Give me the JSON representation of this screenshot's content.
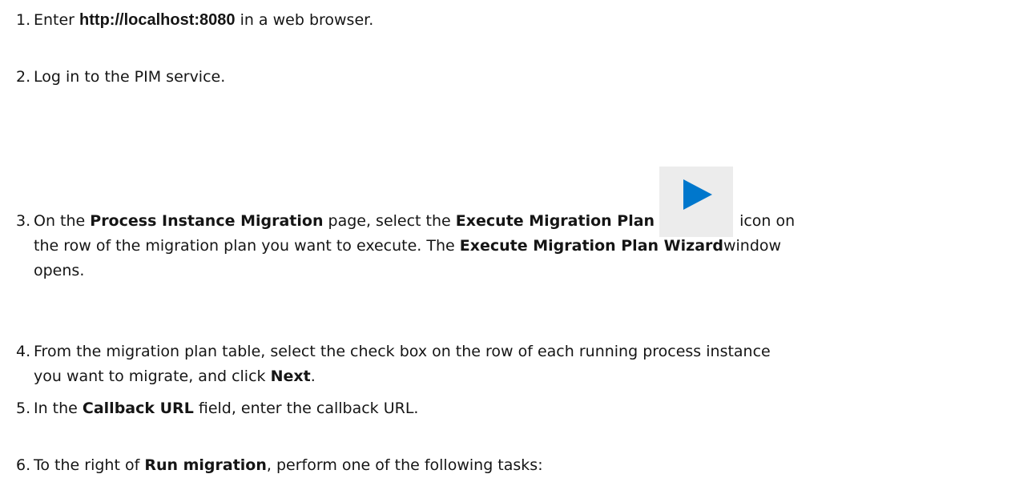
{
  "steps": [
    {
      "num": "1.",
      "pre": "Enter ",
      "strong": "http://localhost:8080",
      "post": " in a web browser."
    },
    {
      "num": "2.",
      "text": "Log in to the PIM service."
    },
    {
      "num": "3.",
      "p1": "On the ",
      "b1": "Process Instance Migration",
      "p2": " page, select the ",
      "b2": "Execute Migration Plan",
      "icon": "play-icon",
      "p3": "icon on",
      "line2_pre": "the row of the migration plan you want to execute. The ",
      "b3": "Execute Migration Plan Wizard",
      "line2_post": "window",
      "line3": "opens."
    },
    {
      "num": "4.",
      "line1": "From the migration plan table, select the check box on the row of each running process instance",
      "line2_pre": "you want to migrate, and click ",
      "b1": "Next",
      "line2_post": "."
    },
    {
      "num": "5.",
      "pre": "In the ",
      "b1": "Callback URL",
      "post": " field, enter the callback URL."
    },
    {
      "num": "6.",
      "pre": "To the right of ",
      "b1": "Run migration",
      "post": ", perform one of the following tasks:"
    }
  ],
  "colors": {
    "text": "#151515",
    "icon_bg": "#ececec",
    "play_icon": "#0077cc"
  }
}
